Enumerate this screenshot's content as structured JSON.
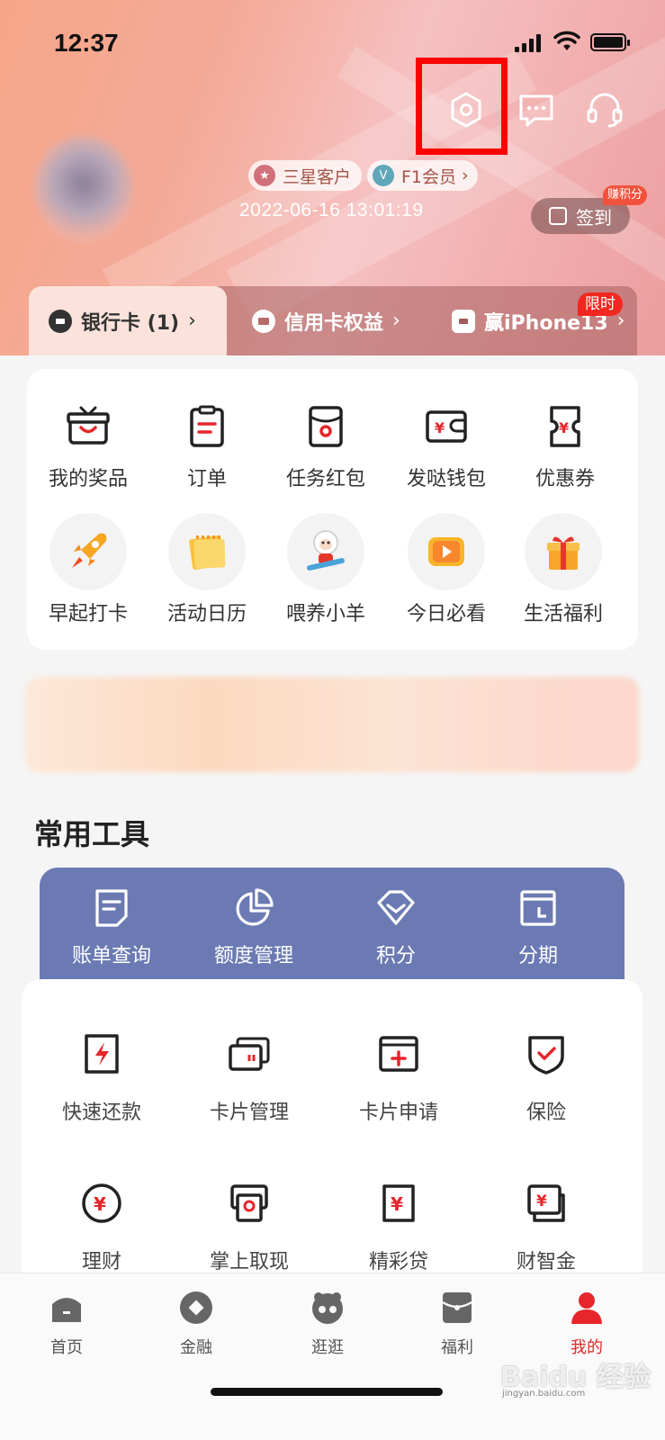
{
  "status_bar": {
    "time": "12:37"
  },
  "profile": {
    "tier_badge": "三星客户",
    "member_badge": "F1会员",
    "timestamp": "2022-06-16 13:01:19",
    "signin_label": "签到",
    "earn_points_tag": "赚积分"
  },
  "card_tabs": [
    {
      "label": "银行卡 (1)"
    },
    {
      "label": "信用卡权益"
    },
    {
      "label": "赢iPhone13"
    }
  ],
  "limited_tag": "限时",
  "quick_grid": {
    "row1": [
      {
        "label": "我的奖品",
        "icon": "prize-box-icon"
      },
      {
        "label": "订单",
        "icon": "clipboard-icon"
      },
      {
        "label": "任务红包",
        "icon": "red-envelope-icon"
      },
      {
        "label": "发哒钱包",
        "icon": "wallet-icon"
      },
      {
        "label": "优惠券",
        "icon": "coupon-icon"
      }
    ],
    "row2": [
      {
        "label": "早起打卡",
        "icon": "rocket-icon"
      },
      {
        "label": "活动日历",
        "icon": "calendar-icon"
      },
      {
        "label": "喂养小羊",
        "icon": "sheep-icon"
      },
      {
        "label": "今日必看",
        "icon": "video-play-icon"
      },
      {
        "label": "生活福利",
        "icon": "gift-icon"
      }
    ]
  },
  "common_tools": {
    "title": "常用工具",
    "top": [
      {
        "label": "账单查询",
        "icon": "bill-icon"
      },
      {
        "label": "额度管理",
        "icon": "pie-chart-icon"
      },
      {
        "label": "积分",
        "icon": "diamond-icon"
      },
      {
        "label": "分期",
        "icon": "installment-icon"
      }
    ],
    "services": [
      {
        "label": "快速还款",
        "icon": "lightning-card-icon"
      },
      {
        "label": "卡片管理",
        "icon": "cards-icon"
      },
      {
        "label": "卡片申请",
        "icon": "card-add-icon"
      },
      {
        "label": "保险",
        "icon": "shield-check-icon"
      },
      {
        "label": "理财",
        "icon": "yuan-circle-icon"
      },
      {
        "label": "掌上取现",
        "icon": "cash-withdraw-icon"
      },
      {
        "label": "精彩贷",
        "icon": "loan-icon"
      },
      {
        "label": "财智金",
        "icon": "wealth-icon"
      }
    ]
  },
  "bottom_nav": [
    {
      "label": "首页",
      "icon": "home-icon"
    },
    {
      "label": "金融",
      "icon": "finance-icon"
    },
    {
      "label": "逛逛",
      "icon": "browse-icon"
    },
    {
      "label": "福利",
      "icon": "welfare-icon"
    },
    {
      "label": "我的",
      "icon": "profile-icon",
      "active": true
    }
  ],
  "colors": {
    "accent_red": "#e6262b",
    "tools_bar": "#6b7ab3",
    "highlight": "#ff0000"
  }
}
